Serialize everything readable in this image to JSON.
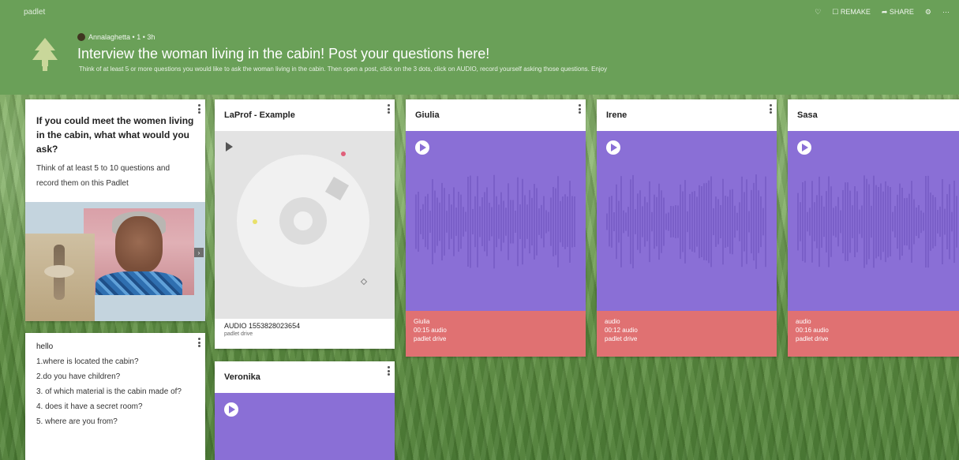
{
  "app": {
    "name": "padlet",
    "controls": [
      {
        "label": "",
        "icon": "heart-icon"
      },
      {
        "label": "☐ REMAKE",
        "icon": "remake-icon"
      },
      {
        "label": "➦ SHARE",
        "icon": "share-icon"
      }
    ]
  },
  "board": {
    "author": "Annalaghetta • 1 • 3h",
    "title": "Interview the woman living in the cabin! Post your questions here!",
    "description": "Think of at least 5 or more questions you would like to ask the woman living in the cabin. Then open a post, click on the 3 dots, click on AUDIO, record yourself asking those questions. Enjoy"
  },
  "cards": {
    "intro": {
      "title": "If you could meet the women living in the cabin, what what would you ask?",
      "body": "Think of at least 5 to 10 questions and record them on this Padlet"
    },
    "notes": {
      "header": "hello",
      "lines": [
        "1.where is located the cabin?",
        "2.do you have children?",
        "3. of which material is the cabin made of?",
        "4. does it have a secret room?",
        "5. where are you from?"
      ]
    },
    "example": {
      "title": "LaProf - Example",
      "caption": "AUDIO 1553828023654",
      "caption_sub": "padlet drive"
    },
    "veronika": {
      "title": "Veronika"
    },
    "giulia": {
      "title": "Giulia",
      "footer": [
        "Giulia",
        "00:15 audio",
        "padlet drive"
      ]
    },
    "irene": {
      "title": "Irene",
      "footer": [
        "audio",
        "00:12 audio",
        "padlet drive"
      ]
    },
    "sasa": {
      "title": "Sasa",
      "footer": [
        "audio",
        "00:16 audio",
        "padlet drive"
      ]
    }
  },
  "colors": {
    "header": "#6aa058",
    "audio": "#8a6fd6",
    "footer": "#e07172"
  }
}
